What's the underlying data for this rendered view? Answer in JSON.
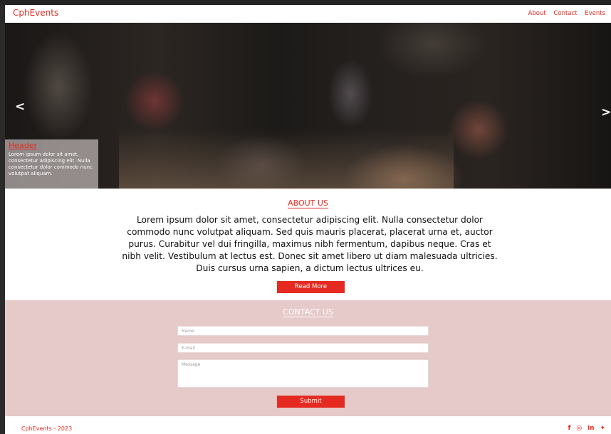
{
  "nav": {
    "brand": "CphEvents",
    "links": [
      "About",
      "Contact",
      "Events"
    ]
  },
  "hero": {
    "prev_arrow": "<",
    "next_arrow": ">",
    "caption_title": "Header",
    "caption_text": "Lorem ipsum dolor sit amet, consectetur adipiscing elit. Nulla consectetur dolor commodo nunc volutpat aliquam."
  },
  "about": {
    "title": "ABOUT US",
    "text": "Lorem ipsum dolor sit amet, consectetur adipiscing elit. Nulla consectetur dolor commodo nunc volutpat aliquam. Sed quis mauris placerat, placerat urna et, auctor purus. Curabitur vel dui fringilla, maximus nibh fermentum, dapibus neque. Cras et nibh velit. Vestibulum at lectus est. Donec sit amet libero ut diam malesuada ultricies. Duis cursus urna sapien, a dictum lectus ultrices eu.",
    "button": "Read More"
  },
  "contact": {
    "title": "CONTACT US",
    "name_placeholder": "Name",
    "email_placeholder": "E-mail",
    "message_placeholder": "Message",
    "submit": "Submit"
  },
  "footer": {
    "copyright": "CphEvents - 2023",
    "social_icons": [
      "facebook-icon",
      "instagram-icon",
      "linkedin-icon",
      "twitter-icon"
    ]
  },
  "colors": {
    "accent": "#e52b21",
    "contact_bg": "#e6c9c9"
  }
}
